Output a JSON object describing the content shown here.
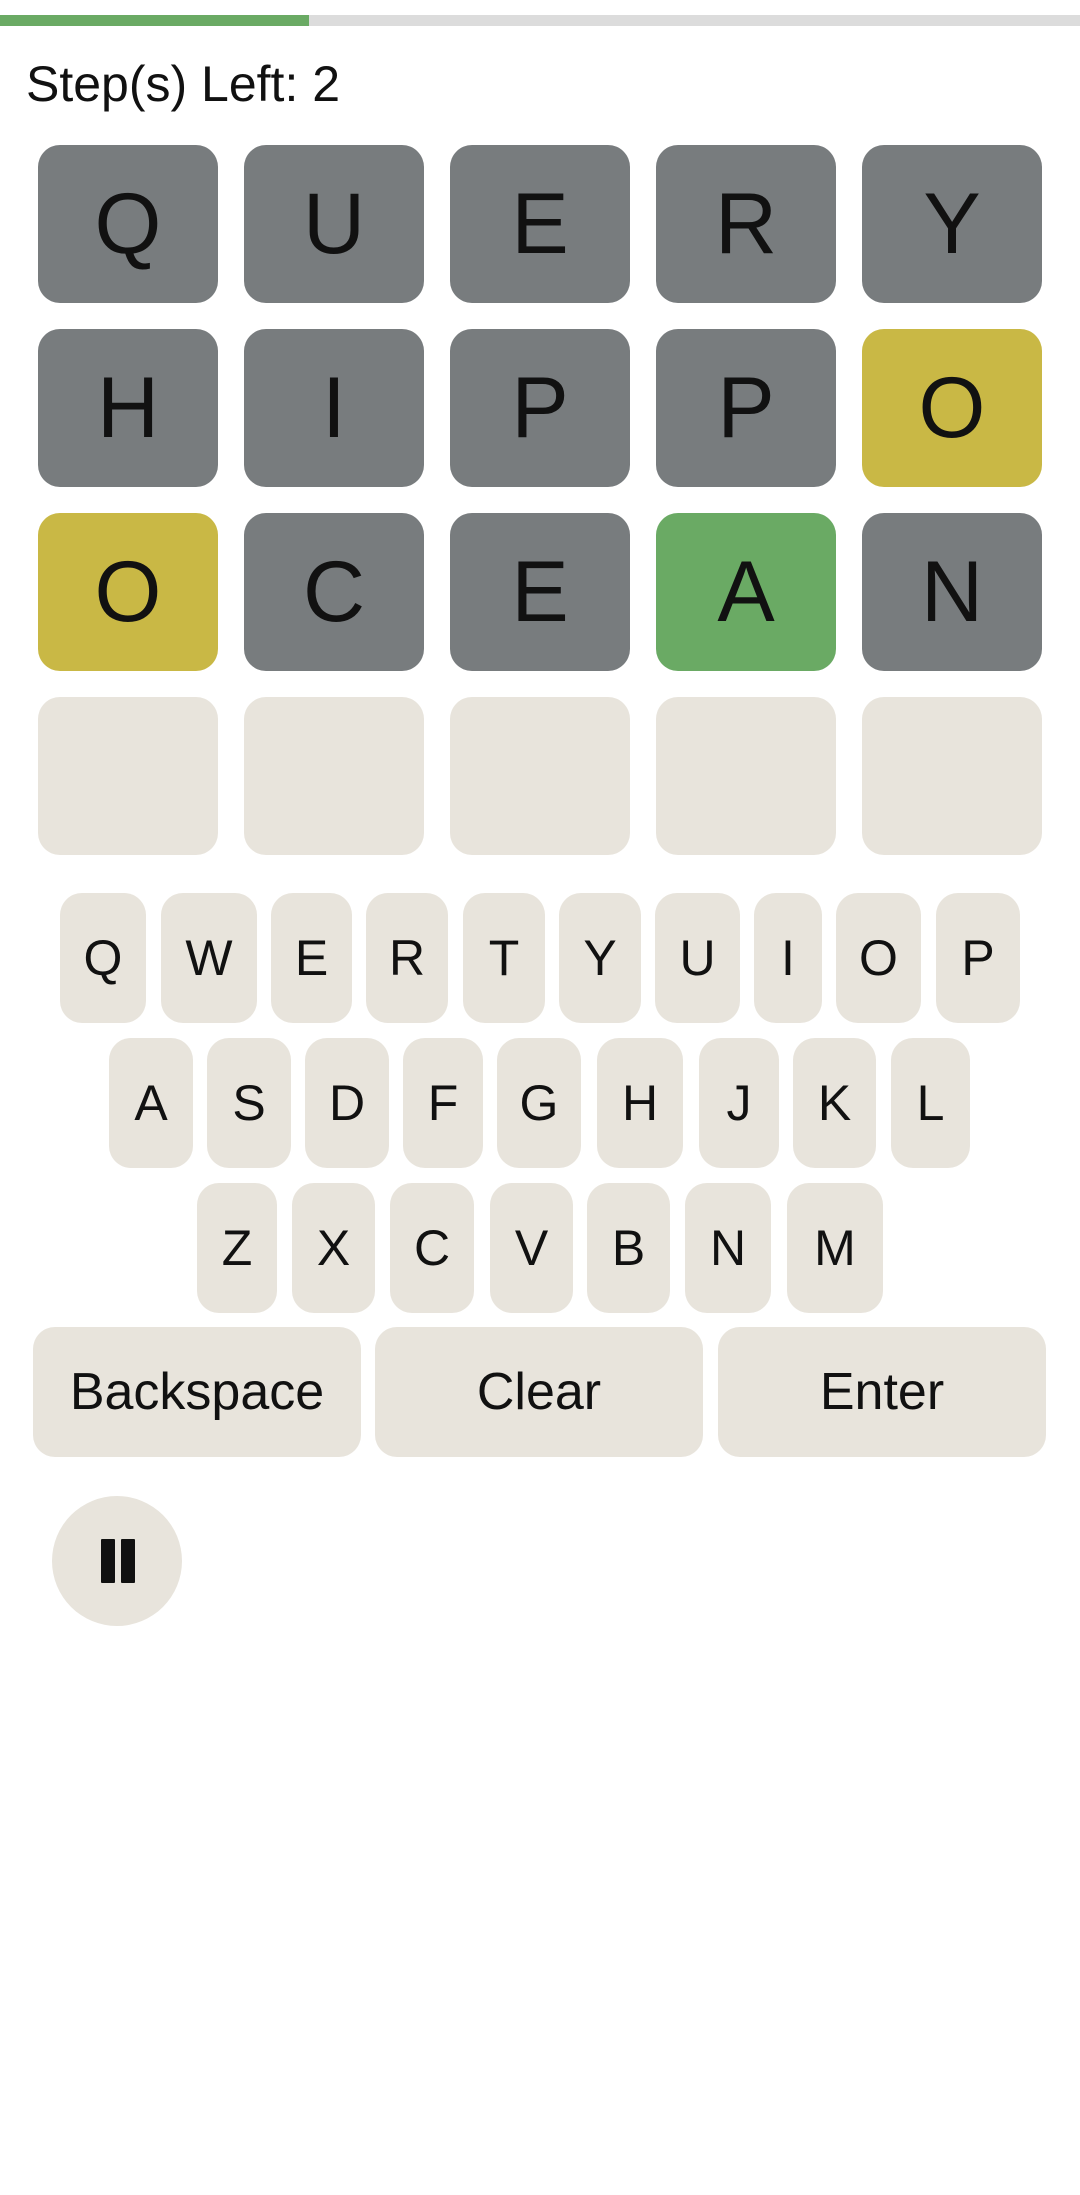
{
  "progress": {
    "fraction": 0.286,
    "fill_color": "#6aaa64",
    "track_color": "#dcdcdc"
  },
  "steps_label": "Step(s) Left: 2",
  "colors": {
    "absent": "#787c7e",
    "present": "#c9b845",
    "correct": "#6aaa64",
    "empty": "#e8e4dc",
    "key": "#e8e4dc"
  },
  "board": {
    "rows": [
      [
        {
          "letter": "Q",
          "state": "absent"
        },
        {
          "letter": "U",
          "state": "absent"
        },
        {
          "letter": "E",
          "state": "absent"
        },
        {
          "letter": "R",
          "state": "absent"
        },
        {
          "letter": "Y",
          "state": "absent"
        }
      ],
      [
        {
          "letter": "H",
          "state": "absent"
        },
        {
          "letter": "I",
          "state": "absent"
        },
        {
          "letter": "P",
          "state": "absent"
        },
        {
          "letter": "P",
          "state": "absent"
        },
        {
          "letter": "O",
          "state": "present"
        }
      ],
      [
        {
          "letter": "O",
          "state": "present"
        },
        {
          "letter": "C",
          "state": "absent"
        },
        {
          "letter": "E",
          "state": "absent"
        },
        {
          "letter": "A",
          "state": "correct"
        },
        {
          "letter": "N",
          "state": "absent"
        }
      ],
      [
        {
          "letter": "",
          "state": "empty"
        },
        {
          "letter": "",
          "state": "empty"
        },
        {
          "letter": "",
          "state": "empty"
        },
        {
          "letter": "",
          "state": "empty"
        },
        {
          "letter": "",
          "state": "empty"
        }
      ]
    ]
  },
  "keyboard": {
    "rows": [
      [
        "Q",
        "W",
        "E",
        "R",
        "T",
        "Y",
        "U",
        "I",
        "O",
        "P"
      ],
      [
        "A",
        "S",
        "D",
        "F",
        "G",
        "H",
        "J",
        "K",
        "L"
      ],
      [
        "Z",
        "X",
        "C",
        "V",
        "B",
        "N",
        "M"
      ]
    ],
    "actions": {
      "backspace": "Backspace",
      "clear": "Clear",
      "enter": "Enter"
    }
  },
  "pause": {
    "icon": "pause-icon"
  }
}
